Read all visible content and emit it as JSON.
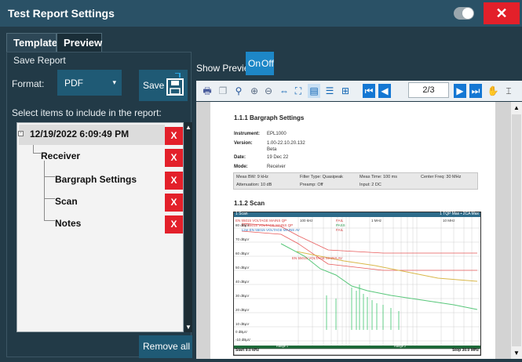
{
  "window": {
    "title": "Test Report Settings",
    "close_label": "✕"
  },
  "tabs": [
    {
      "label": "Templates"
    },
    {
      "label": "Preview"
    }
  ],
  "save_report": {
    "heading": "Save Report",
    "format_label": "Format:",
    "format_value": "PDF",
    "save_label": "Save"
  },
  "items": {
    "heading": "Select items to include in the report:",
    "tree": [
      {
        "label": "12/19/2022 6:09:49 PM",
        "x": "X"
      },
      {
        "label": "Receiver",
        "x": "X"
      },
      {
        "label": "Bargraph Settings",
        "x": "X"
      },
      {
        "label": "Scan",
        "x": "X"
      },
      {
        "label": "Notes",
        "x": "X"
      }
    ],
    "remove_all_label": "Remove all"
  },
  "preview": {
    "show_preview_label": "Show Preview",
    "on_label": "On",
    "off_label": "Off",
    "page_indicator": "2/3"
  },
  "document": {
    "section1_title": "1.1.1   Bargraph Settings",
    "rows": [
      {
        "k": "Instrument:",
        "v": "EPL1000"
      },
      {
        "k": "Version:",
        "v": "1.00-22.10.20.132"
      },
      {
        "k": "",
        "v": "Beta"
      },
      {
        "k": "Date:",
        "v": "19 Dec 22"
      },
      {
        "k": "Mode:",
        "v": "Receiver"
      }
    ],
    "meas_table": [
      [
        "Meas BW: 9 kHz",
        "Filter Type: Quasipeak",
        "Meas Time: 100 ms",
        "Center Freq: 30 MHz"
      ],
      [
        "Attenuation: 10 dB",
        "Preamp: Off",
        "Input: 2 DC",
        ""
      ]
    ],
    "section2_title": "1.1.2   Scan",
    "plot": {
      "header_left": "1 Scan",
      "header_right": "1 TQP Max • 2CA Max",
      "limits": [
        "EN 55015 VOLTAGE MAINS QP",
        "EN 55015 VOLTAGE MAINS QP",
        "Line EN 55015 VOLTAGE MAINS AV"
      ],
      "status": [
        "FAIL",
        "PASS",
        "FAIL"
      ],
      "mid_limit_label": "EN 55015 VOLTAGE MAINS AV",
      "freq_labels": [
        "100 kHz",
        "1 MHz",
        "10 MHz"
      ],
      "y_labels": [
        "80 dBµV",
        "70 dBµV",
        "60 dBµV",
        "50 dBµV",
        "40 dBµV",
        "30 dBµV",
        "20 dBµV",
        "10 dBµV",
        "0 dBµV",
        "-10 dBµV"
      ],
      "range_labels": [
        "Range 1",
        "Range 2"
      ],
      "start_label": "Start 9.0 kHz",
      "stop_label": "Stop 30.0 MHz"
    }
  },
  "colors": {
    "accent": "#1d87c7",
    "danger": "#e3202a",
    "titlebar": "#2a5166"
  }
}
